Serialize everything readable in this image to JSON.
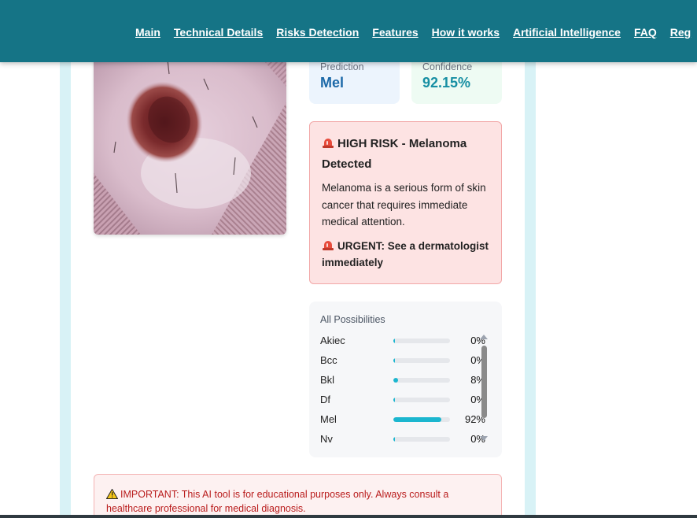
{
  "nav": {
    "items": [
      "Main",
      "Technical Details",
      "Risks Detection",
      "Features",
      "How it works",
      "Artificial Intelligence",
      "FAQ",
      "Reg"
    ]
  },
  "result": {
    "prediction_label": "Prediction",
    "prediction_value": "Mel",
    "confidence_label": "Confidence",
    "confidence_value": "92.15%"
  },
  "risk": {
    "icon": "siren-icon",
    "title": "HIGH RISK - Melanoma Detected",
    "description": "Melanoma is a serious form of skin cancer that requires immediate medical attention.",
    "urgent": "URGENT: See a dermatologist immediately",
    "colors": {
      "background": "#fde3e3",
      "border": "#f2a7a7"
    }
  },
  "possibilities": {
    "heading": "All Possibilities",
    "items": [
      {
        "name": "Akiec",
        "pct_label": "0%",
        "fraction": 0.0
      },
      {
        "name": "Bcc",
        "pct_label": "0%",
        "fraction": 0.0
      },
      {
        "name": "Bkl",
        "pct_label": "8%",
        "fraction": 0.08
      },
      {
        "name": "Df",
        "pct_label": "0%",
        "fraction": 0.0
      },
      {
        "name": "Mel",
        "pct_label": "92%",
        "fraction": 0.92
      },
      {
        "name": "Nv",
        "pct_label": "0%",
        "fraction": 0.0
      }
    ],
    "bar_color": "#1bb6cf"
  },
  "disclaimer": {
    "icon": "warning-icon",
    "text": "IMPORTANT: This AI tool is for educational purposes only. Always consult a healthcare professional for medical diagnosis."
  },
  "colors": {
    "nav_background": "#157486",
    "accent": "#178fa3"
  }
}
